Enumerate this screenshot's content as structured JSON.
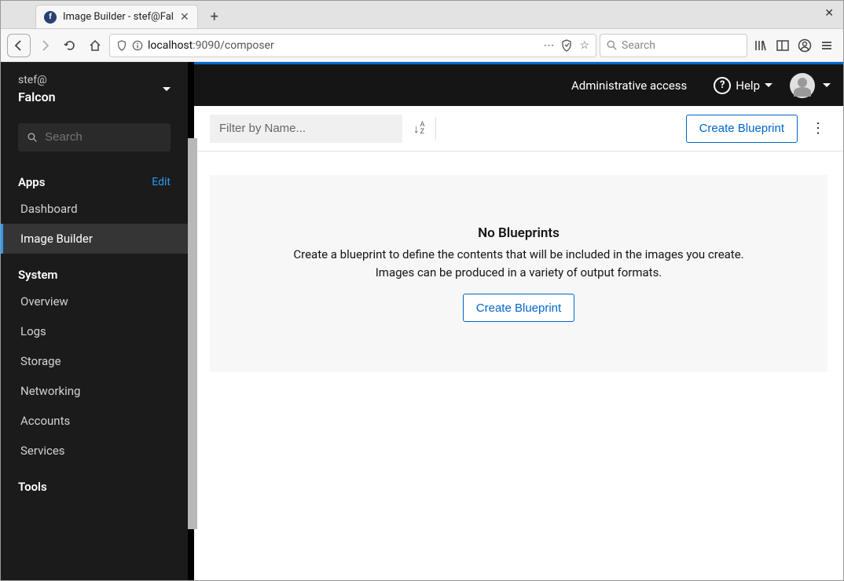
{
  "browser": {
    "tab_title": "Image Builder - stef@Fal",
    "url_host": "localhost",
    "url_port_path": ":9090/composer",
    "search_placeholder": "Search"
  },
  "sidebar": {
    "user": "stef@",
    "host": "Falcon",
    "search_placeholder": "Search",
    "apps_label": "Apps",
    "edit_label": "Edit",
    "apps_items": [
      {
        "label": "Dashboard"
      },
      {
        "label": "Image Builder"
      }
    ],
    "system_label": "System",
    "system_items": [
      {
        "label": "Overview"
      },
      {
        "label": "Logs"
      },
      {
        "label": "Storage"
      },
      {
        "label": "Networking"
      },
      {
        "label": "Accounts"
      },
      {
        "label": "Services"
      }
    ],
    "tools_label": "Tools"
  },
  "topbar": {
    "admin_text": "Administrative access",
    "help_label": "Help"
  },
  "toolbar": {
    "filter_placeholder": "Filter by Name...",
    "create_label": "Create Blueprint"
  },
  "empty": {
    "title": "No Blueprints",
    "desc1": "Create a blueprint to define the contents that will be included in the images you create.",
    "desc2": "Images can be produced in a variety of output formats.",
    "button": "Create Blueprint"
  }
}
